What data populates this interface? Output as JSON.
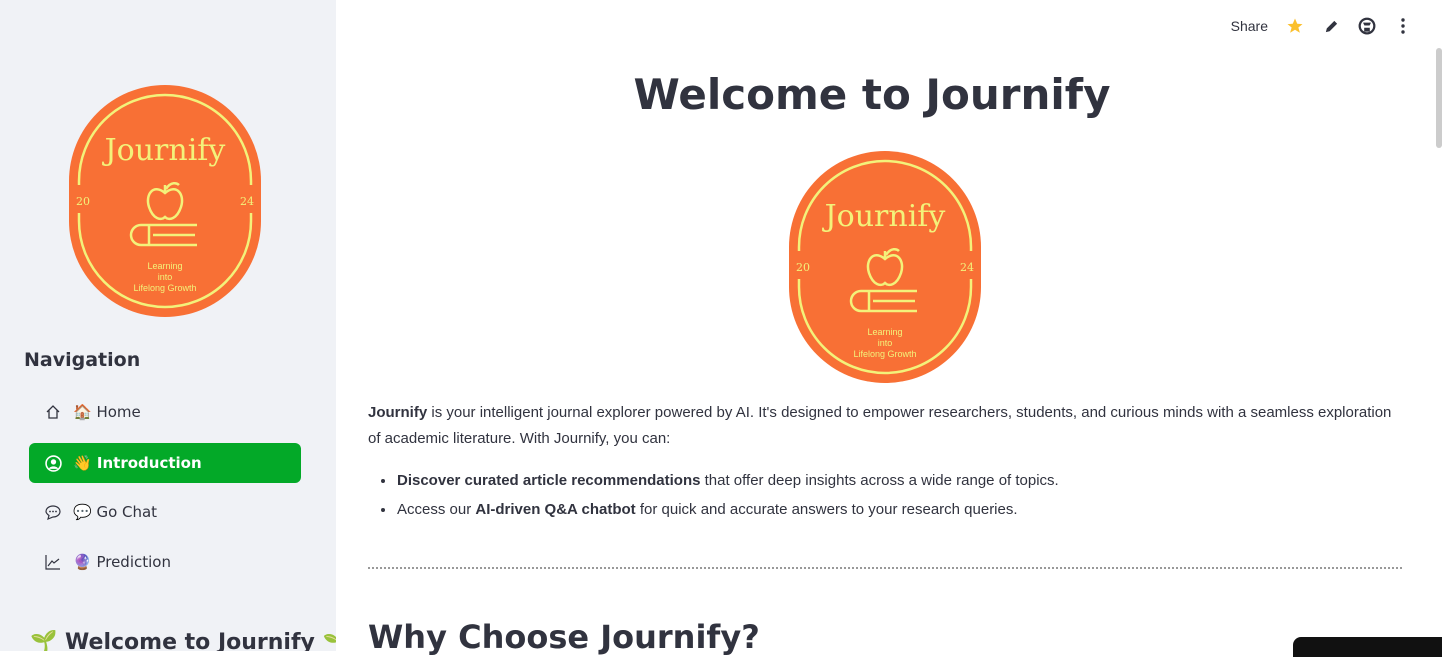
{
  "logo": {
    "name": "Journify",
    "year_left": "20",
    "year_right": "24",
    "tagline": [
      "Learning",
      "into",
      "Lifelong Growth"
    ]
  },
  "sidebar": {
    "nav_title": "Navigation",
    "items": [
      {
        "label": "🏠 Home",
        "icon": "home-icon"
      },
      {
        "label": "👋 Introduction",
        "icon": "user-circle-icon",
        "active": true
      },
      {
        "label": "💬 Go Chat",
        "icon": "chat-icon"
      },
      {
        "label": "🔮 Prediction",
        "icon": "chart-line-icon"
      }
    ],
    "welcome": "🌱 Welcome to Journify 🌱"
  },
  "toolbar": {
    "share": "Share"
  },
  "main": {
    "title": "Welcome to Journify",
    "intro_bold": "Journify",
    "intro_rest": " is your intelligent journal explorer powered by AI. It's designed to empower researchers, students, and curious minds with a seamless exploration of academic literature. With Journify, you can:",
    "bullets": [
      {
        "pre": "",
        "bold": "Discover curated article recommendations",
        "post": " that offer deep insights across a wide range of topics."
      },
      {
        "pre": "Access our ",
        "bold": "AI-driven Q&A chatbot",
        "post": " for quick and accurate answers to your research queries."
      }
    ],
    "section_title": "Why Choose Journify?"
  },
  "colors": {
    "accent": "#03a928",
    "logo_bg": "#f87035",
    "logo_line": "#f3f27a",
    "star": "#fbc02d"
  }
}
